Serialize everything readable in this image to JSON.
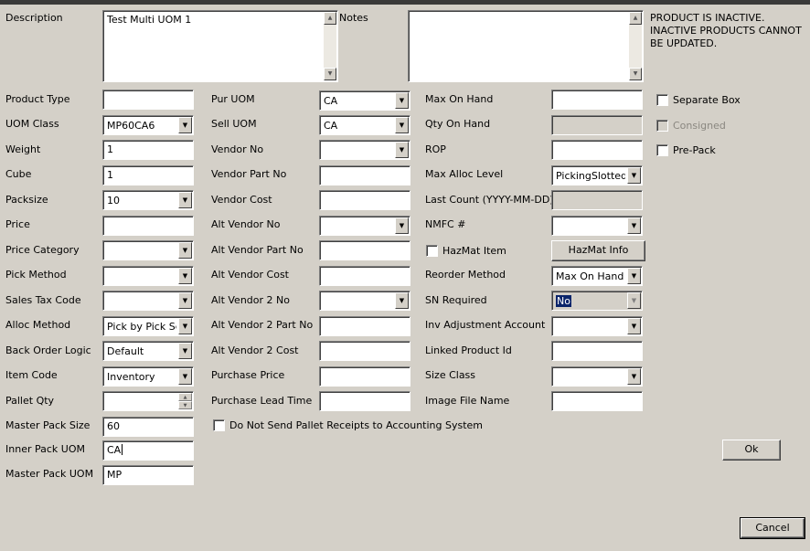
{
  "labels": {
    "description": "Description",
    "notes": "Notes",
    "product_type": "Product Type",
    "uom_class": "UOM Class",
    "weight": "Weight",
    "cube": "Cube",
    "packsize": "Packsize",
    "price": "Price",
    "price_category": "Price Category",
    "pick_method": "Pick Method",
    "sales_tax_code": "Sales Tax Code",
    "alloc_method": "Alloc Method",
    "back_order_logic": "Back Order Logic",
    "item_code": "Item Code",
    "pallet_qty": "Pallet Qty",
    "master_pack_size": "Master Pack Size",
    "inner_pack_uom": "Inner Pack UOM",
    "master_pack_uom": "Master Pack UOM",
    "pur_uom": "Pur UOM",
    "sell_uom": "Sell UOM",
    "vendor_no": "Vendor No",
    "vendor_part_no": "Vendor Part No",
    "vendor_cost": "Vendor Cost",
    "alt_vendor_no": "Alt Vendor No",
    "alt_vendor_part_no": "Alt Vendor Part No",
    "alt_vendor_cost": "Alt Vendor Cost",
    "alt_vendor_2_no": "Alt Vendor 2 No",
    "alt_vendor_2_part_no": "Alt Vendor 2 Part No",
    "alt_vendor_2_cost": "Alt Vendor 2 Cost",
    "purchase_price": "Purchase Price",
    "purchase_lead_time": "Purchase Lead Time",
    "max_on_hand": "Max On Hand",
    "qty_on_hand": "Qty On Hand",
    "rop": "ROP",
    "max_alloc_level": "Max Alloc Level",
    "last_count": "Last Count (YYYY-MM-DD)",
    "nmfc": "NMFC #",
    "hazmat_item": "HazMat Item",
    "reorder_method": "Reorder Method",
    "sn_required": "SN Required",
    "inv_adjustment_account": "Inv Adjustment Account",
    "linked_product_id": "Linked Product Id",
    "size_class": "Size Class",
    "image_file_name": "Image File Name",
    "separate_box": "Separate Box",
    "consigned": "Consigned",
    "pre_pack": "Pre-Pack",
    "do_not_send": "Do Not Send Pallet Receipts to Accounting System"
  },
  "values": {
    "description": "Test Multi UOM 1",
    "notes": "",
    "product_type": "",
    "uom_class": "MP60CA6",
    "weight": "1",
    "cube": "1",
    "packsize": "10",
    "price": "",
    "price_category": "",
    "pick_method": "",
    "sales_tax_code": "",
    "alloc_method": "Pick by Pick Sec",
    "back_order_logic": "Default",
    "item_code": "Inventory",
    "pallet_qty": "",
    "master_pack_size": "60",
    "inner_pack_uom": "CA",
    "master_pack_uom": "MP",
    "pur_uom": "CA",
    "sell_uom": "CA",
    "vendor_no": "",
    "vendor_part_no": "",
    "vendor_cost": "",
    "alt_vendor_no": "",
    "alt_vendor_part_no": "",
    "alt_vendor_cost": "",
    "alt_vendor_2_no": "",
    "alt_vendor_2_part_no": "",
    "alt_vendor_2_cost": "",
    "purchase_price": "",
    "purchase_lead_time": "",
    "max_on_hand": "",
    "qty_on_hand": "",
    "rop": "",
    "max_alloc_level": "PickingSlotted",
    "last_count": "",
    "nmfc": "",
    "reorder_method": "Max On Hand",
    "sn_required": "No",
    "inv_adjustment_account": "",
    "linked_product_id": "",
    "size_class": "",
    "image_file_name": ""
  },
  "checkboxes": {
    "separate_box": false,
    "consigned": false,
    "pre_pack": false,
    "hazmat_item": false,
    "do_not_send": false
  },
  "status_message": "PRODUCT IS INACTIVE. INACTIVE PRODUCTS CANNOT BE UPDATED.",
  "buttons": {
    "hazmat_info": "HazMat Info",
    "ok": "Ok",
    "cancel": "Cancel"
  },
  "icons": {
    "dropdown": "chevron-down-icon",
    "spinner": "spinner-icon",
    "scroll_up": "scroll-up-icon",
    "scroll_down": "scroll-down-icon"
  }
}
